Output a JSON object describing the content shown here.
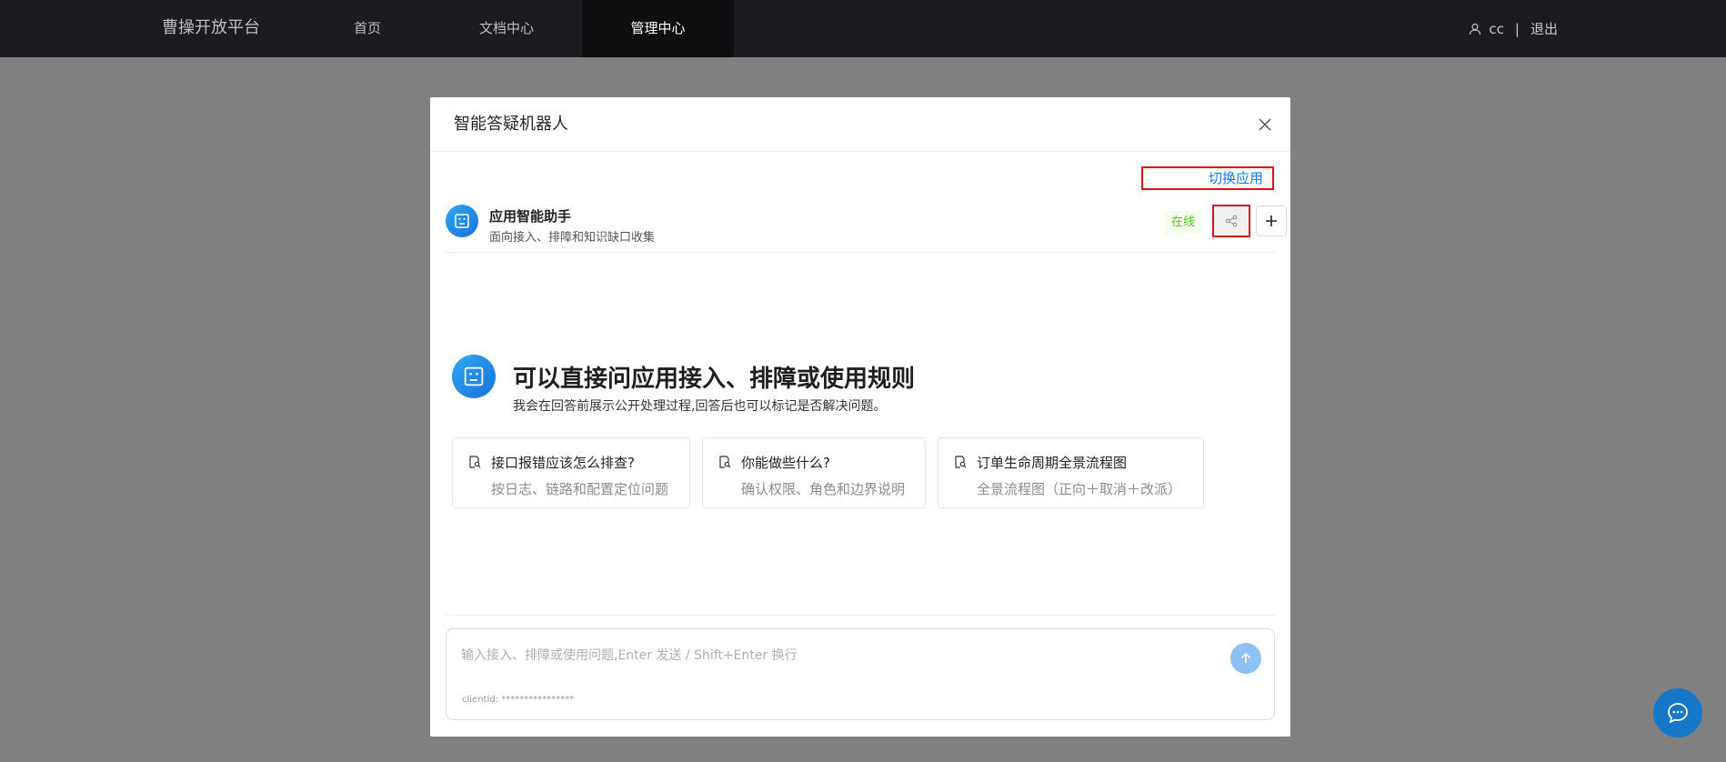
{
  "nav": {
    "brand": "曹操开放平台",
    "items": [
      {
        "label": "首页",
        "active": false
      },
      {
        "label": "文档中心",
        "active": false
      },
      {
        "label": "管理中心",
        "active": true
      }
    ],
    "user": "cc",
    "separator": "|",
    "logout": "退出"
  },
  "modal": {
    "title": "智能答疑机器人",
    "switch_app": "切换应用",
    "app": {
      "name": "应用智能助手",
      "description": "面向接入、排障和知识缺口收集",
      "status": "在线"
    },
    "welcome": {
      "title": "可以直接问应用接入、排障或使用规则",
      "subtitle": "我会在回答前展示公开处理过程,回答后也可以标记是否解决问题。"
    },
    "prompts": [
      {
        "title": "接口报错应该怎么排查?",
        "desc": "按日志、链路和配置定位问题"
      },
      {
        "title": "你能做些什么?",
        "desc": "确认权限、角色和边界说明"
      },
      {
        "title": "订单生命周期全景流程图",
        "desc": "全景流程图（正向＋取消＋改派）"
      }
    ],
    "input": {
      "value": "",
      "placeholder": "输入接入、排障或使用问题,Enter 发送 / Shift+Enter 换行"
    },
    "client_id": "clientId: ****************"
  },
  "colors": {
    "accent": "#1677ff",
    "nav_bg": "#1a1c20",
    "status_green": "#52c41a",
    "highlight_red": "#e0101a"
  }
}
